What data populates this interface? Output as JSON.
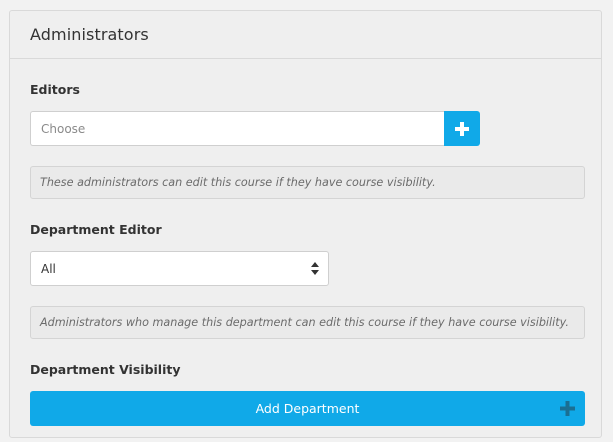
{
  "panel": {
    "title": "Administrators"
  },
  "editors": {
    "label": "Editors",
    "placeholder": "Choose",
    "add_icon": "plus-icon",
    "help_text": "These administrators can edit this course if they have course visibility."
  },
  "department_editor": {
    "label": "Department Editor",
    "selected": "All",
    "arrow_icon": "up-down-arrows-icon",
    "help_text": "Administrators who manage this department can edit this course if they have course visibility."
  },
  "department_visibility": {
    "label": "Department Visibility",
    "button_label": "Add Department",
    "button_icon": "plus-icon"
  },
  "colors": {
    "accent": "#10a9e8",
    "panel_bg": "#efefef",
    "border": "#d9d9d9"
  }
}
